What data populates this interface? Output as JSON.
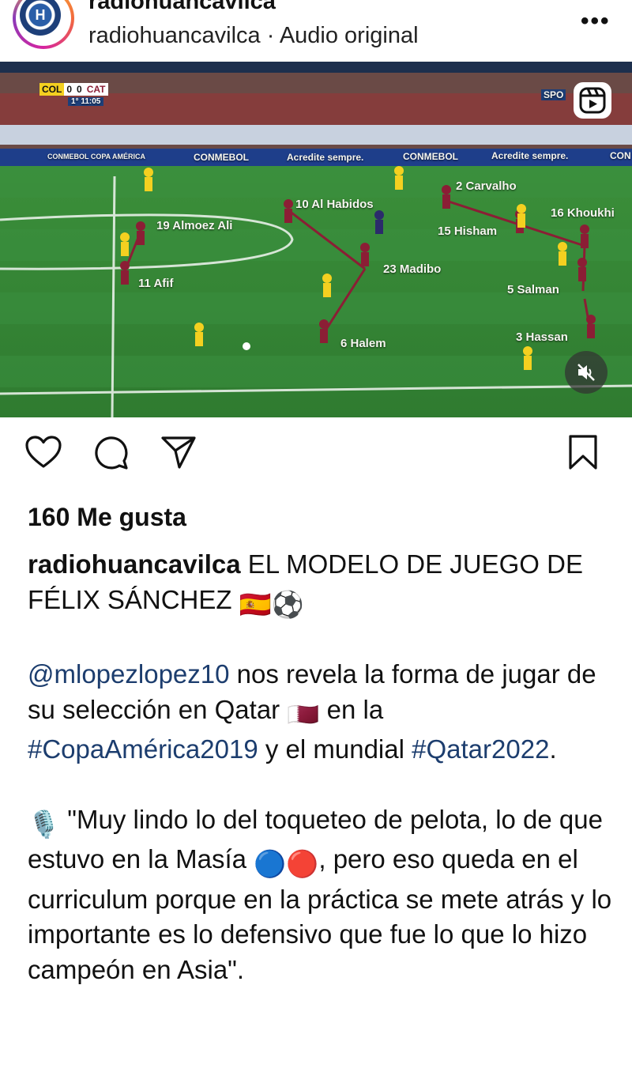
{
  "header": {
    "username": "radiohuancavilca",
    "subtitle": "radiohuancavilca · Audio original",
    "more_icon": "more-dots-icon",
    "avatar_letter": "H"
  },
  "media": {
    "scoreboard": {
      "home": "COL",
      "home_score": "0",
      "away_score": "0",
      "away": "CAT",
      "time": "1° 11:05"
    },
    "broadcast_tag": "SPO",
    "board_texts": [
      "CONMEBOL COPA AMÉRICA",
      "CONMEBOL",
      "Acredite sempre.",
      "CONMEBOL",
      "Acredite sempre.",
      "CON"
    ],
    "players": [
      {
        "label": "2 Carvalho"
      },
      {
        "label": "10 Al Habidos"
      },
      {
        "label": "16 Khoukhi"
      },
      {
        "label": "19 Almoez Ali"
      },
      {
        "label": "15 Hisham"
      },
      {
        "label": "23 Madibo"
      },
      {
        "label": "11 Afif"
      },
      {
        "label": "5 Salman"
      },
      {
        "label": "3 Hassan"
      },
      {
        "label": "6 Halem"
      }
    ],
    "reels_icon": "reels-icon",
    "mute_icon": "muted-speaker-icon"
  },
  "actions": {
    "like_icon": "heart-icon",
    "comment_icon": "comment-icon",
    "share_icon": "send-icon",
    "save_icon": "bookmark-icon"
  },
  "likes_text": "160 Me gusta",
  "caption": {
    "username": "radiohuancavilca",
    "title": "EL MODELO DE JUEGO DE FÉLIX SÁNCHEZ",
    "title_emojis": "🇪🇸⚽",
    "mention": "@mlopezlopez10",
    "p2_a": "nos revela la forma de jugar de su selección en Qatar",
    "qatar_flag": "🇶🇦",
    "p2_b": "en la",
    "hashtag1": "#CopaAmérica2019",
    "p2_c": "y el mundial",
    "hashtag2": "#Qatar2022",
    "p2_d": ".",
    "mic": "🎙️",
    "p3_a": "\"Muy lindo lo del toqueteo de pelota, lo de que estuvo en la Masía",
    "circles": "🔵🔴",
    "p3_b": ", pero eso queda en el curriculum porque en la práctica se mete atrás y lo importante es lo defensivo que fue lo que lo hizo campeón en Asia\"."
  }
}
